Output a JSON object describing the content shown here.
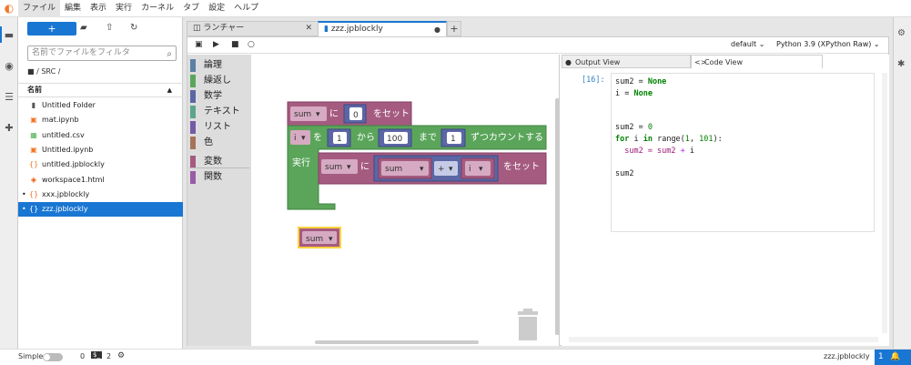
{
  "menu": {
    "items": [
      "ファイル",
      "編集",
      "表示",
      "実行",
      "カーネル",
      "タブ",
      "設定",
      "ヘルプ"
    ]
  },
  "filebrowser": {
    "new_label": "+",
    "search_placeholder": "名前でファイルをフィルタ",
    "breadcrumb": "/ SRC /",
    "column_header": "名前",
    "files": [
      {
        "name": "Untitled Folder",
        "icon": "folder-icon",
        "running": false,
        "selected": false
      },
      {
        "name": "mat.ipynb",
        "icon": "notebook-icon",
        "running": false,
        "selected": false
      },
      {
        "name": "untitled.csv",
        "icon": "csv-icon",
        "running": false,
        "selected": false
      },
      {
        "name": "Untitled.ipynb",
        "icon": "notebook-icon",
        "running": false,
        "selected": false
      },
      {
        "name": "untitled.jpblockly",
        "icon": "json-icon",
        "running": false,
        "selected": false
      },
      {
        "name": "workspace1.html",
        "icon": "html-icon",
        "running": false,
        "selected": false
      },
      {
        "name": "xxx.jpblockly",
        "icon": "json-icon",
        "running": true,
        "selected": false
      },
      {
        "name": "zzz.jpblockly",
        "icon": "json-icon",
        "running": true,
        "selected": true
      }
    ]
  },
  "tabs": [
    {
      "label": "ランチャー"
    },
    {
      "label": "zzz.jpblockly"
    }
  ],
  "notebook_toolbar": {
    "kernel_default": "default",
    "kernel_name": "Python 3.9 (XPython Raw)"
  },
  "toolbox": {
    "categories": [
      {
        "label": "論理",
        "color": "#5b80a5"
      },
      {
        "label": "繰返し",
        "color": "#5ba55b"
      },
      {
        "label": "数学",
        "color": "#5b67a5"
      },
      {
        "label": "テキスト",
        "color": "#5ba58c"
      },
      {
        "label": "リスト",
        "color": "#745ba5"
      },
      {
        "label": "色",
        "color": "#a5745b"
      },
      {
        "label": "変数",
        "color": "#a55b80"
      },
      {
        "label": "関数",
        "color": "#995ba5"
      }
    ]
  },
  "blocks": {
    "set1": {
      "var": "sum",
      "ni": "に",
      "value": "0",
      "set": "をセット"
    },
    "for": {
      "var": "i",
      "wo": "を",
      "from_val": "1",
      "kara": "から",
      "to_val": "100",
      "made": "まで",
      "by_val": "1",
      "count": "ずつカウントする"
    },
    "do_label": "実行",
    "set2": {
      "var": "sum",
      "ni": "に",
      "a": "sum",
      "op": "+",
      "b": "i",
      "set": "をセット"
    },
    "orphan": {
      "var": "sum"
    }
  },
  "right": {
    "output_tab": "Output View",
    "code_tab": "Code View",
    "prompt": "[16]:",
    "code": [
      [
        {
          "t": "sum2 = ",
          "c": ""
        },
        {
          "t": "None",
          "c": "kw"
        }
      ],
      [
        {
          "t": "i = ",
          "c": ""
        },
        {
          "t": "None",
          "c": "kw"
        }
      ],
      [],
      [],
      [
        {
          "t": "sum2 = ",
          "c": ""
        },
        {
          "t": "0",
          "c": "num"
        }
      ],
      [
        {
          "t": "for",
          "c": "kw"
        },
        {
          "t": " i ",
          "c": ""
        },
        {
          "t": "in",
          "c": "kw"
        },
        {
          "t": " range(",
          "c": ""
        },
        {
          "t": "1",
          "c": "num"
        },
        {
          "t": ", ",
          "c": ""
        },
        {
          "t": "101",
          "c": "num"
        },
        {
          "t": "):",
          "c": ""
        }
      ],
      [
        {
          "t": "  sum2 = sum2 ",
          "c": "indent"
        },
        {
          "t": "+",
          "c": "op"
        },
        {
          "t": " i",
          "c": ""
        }
      ],
      [],
      [
        {
          "t": "sum2",
          "c": ""
        }
      ]
    ]
  },
  "statusbar": {
    "mode": "Simple",
    "kernels": "0",
    "terminals": "2",
    "filename": "zzz.jpblockly",
    "notifications": "1"
  }
}
